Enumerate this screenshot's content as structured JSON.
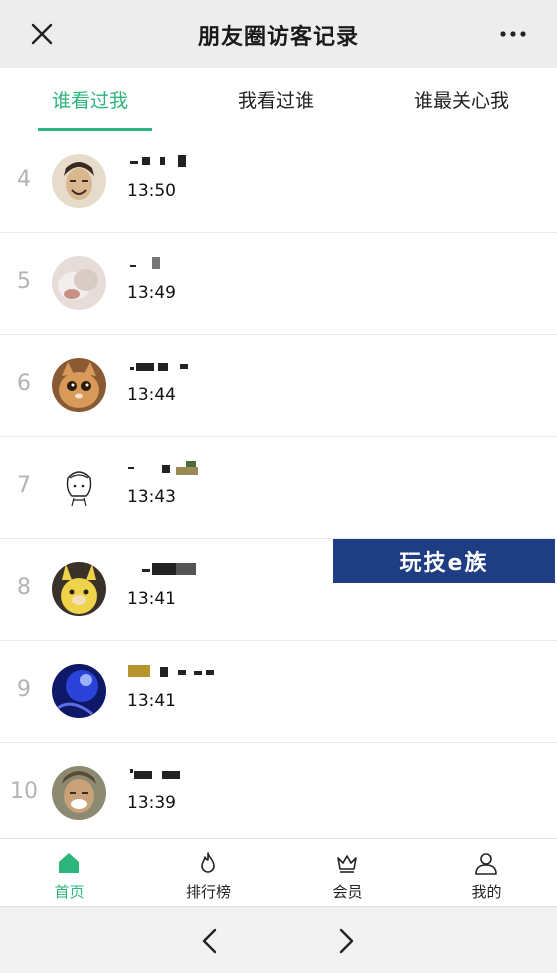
{
  "header": {
    "title": "朋友圈访客记录",
    "close_icon": "close-icon",
    "more_icon": "more-icon"
  },
  "tabs": [
    {
      "label": "谁看过我",
      "active": true
    },
    {
      "label": "我看过谁",
      "active": false
    },
    {
      "label": "谁最关心我",
      "active": false
    }
  ],
  "visitors": [
    {
      "rank": "4",
      "time": "13:50",
      "avatar_color": "#c9b79a"
    },
    {
      "rank": "5",
      "time": "13:49",
      "avatar_color": "#d9c9c1"
    },
    {
      "rank": "6",
      "time": "13:44",
      "avatar_color": "#c08a56"
    },
    {
      "rank": "7",
      "time": "13:43",
      "avatar_color": "#ffffff"
    },
    {
      "rank": "8",
      "time": "13:41",
      "avatar_color": "#d8c24a"
    },
    {
      "rank": "9",
      "time": "13:41",
      "avatar_color": "#1f2f9c"
    },
    {
      "rank": "10",
      "time": "13:39",
      "avatar_color": "#7c6a4f"
    }
  ],
  "watermark": {
    "text": "玩技e族"
  },
  "bottom_nav": [
    {
      "label": "首页",
      "icon": "home-icon",
      "active": true
    },
    {
      "label": "排行榜",
      "icon": "flame-icon",
      "active": false
    },
    {
      "label": "会员",
      "icon": "crown-icon",
      "active": false
    },
    {
      "label": "我的",
      "icon": "user-icon",
      "active": false
    }
  ],
  "browser_bar": {
    "back_icon": "chevron-left-icon",
    "forward_icon": "chevron-right-icon"
  },
  "colors": {
    "accent": "#2db57c",
    "header_bg": "#ededed",
    "rank_gray": "#b3b3b3"
  }
}
